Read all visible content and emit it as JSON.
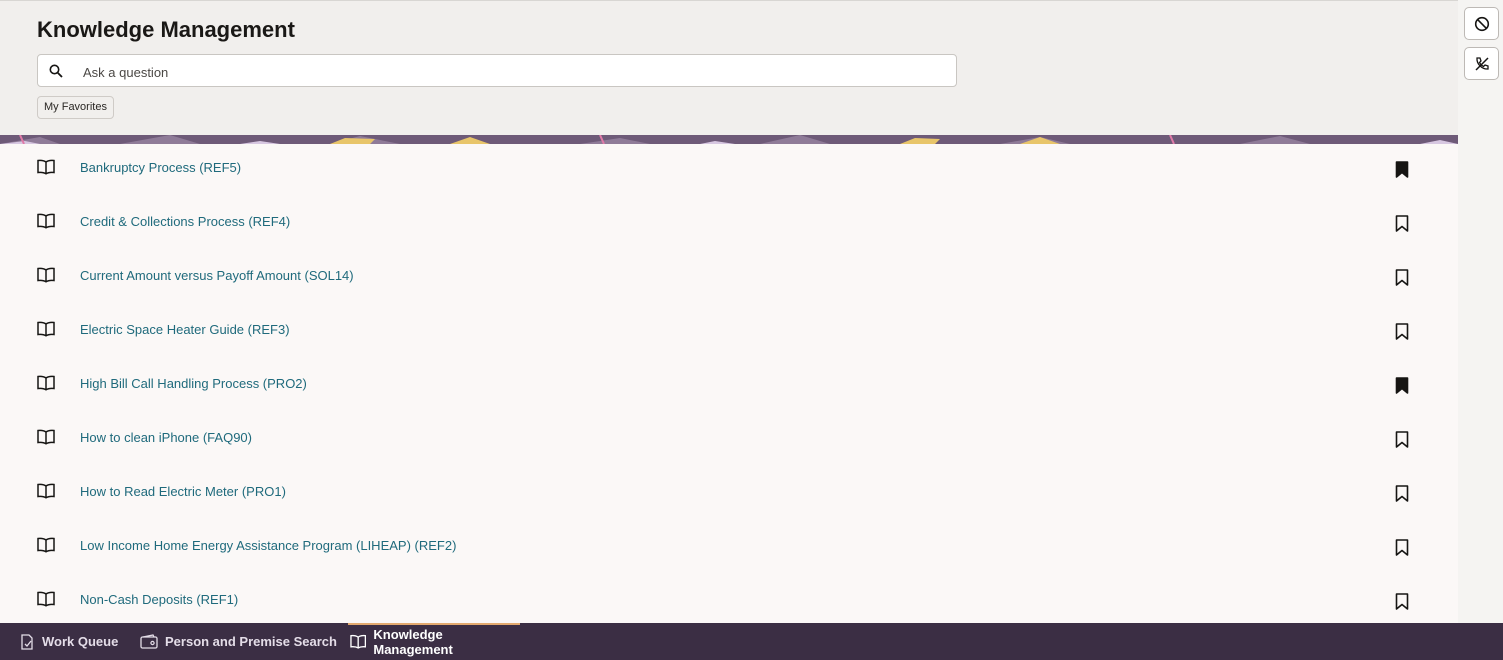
{
  "page": {
    "title": "Knowledge Management"
  },
  "search": {
    "placeholder": "Ask a question",
    "value": ""
  },
  "chips": {
    "favorites_label": "My Favorites"
  },
  "articles": [
    {
      "title": "Bankruptcy Process (REF5)",
      "favorited": true
    },
    {
      "title": "Credit & Collections Process (REF4)",
      "favorited": false
    },
    {
      "title": "Current Amount versus Payoff Amount (SOL14)",
      "favorited": false
    },
    {
      "title": "Electric Space Heater Guide (REF3)",
      "favorited": false
    },
    {
      "title": "High Bill Call Handling Process (PRO2)",
      "favorited": true
    },
    {
      "title": "How to clean iPhone (FAQ90)",
      "favorited": false
    },
    {
      "title": "How to Read Electric Meter (PRO1)",
      "favorited": false
    },
    {
      "title": "Low Income Home Energy Assistance Program (LIHEAP) (REF2)",
      "favorited": false
    },
    {
      "title": "Non-Cash Deposits (REF1)",
      "favorited": false
    }
  ],
  "side_buttons": [
    {
      "icon": "block-icon"
    },
    {
      "icon": "phone-off-icon"
    }
  ],
  "bottom_tabs": [
    {
      "label": "Work Queue",
      "icon": "work-queue-icon",
      "active": false
    },
    {
      "label": "Person and Premise Search",
      "icon": "wallet-icon",
      "active": false
    },
    {
      "label": "Knowledge Management",
      "icon": "book-icon",
      "active": true
    }
  ],
  "colors": {
    "link": "#1f6a7c",
    "bottom_bar": "#3b2e44",
    "active_tab_indicator": "#e3a96f"
  }
}
